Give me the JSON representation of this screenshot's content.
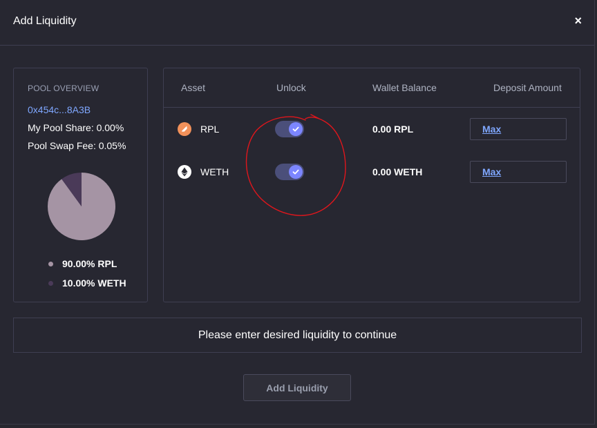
{
  "modal": {
    "title": "Add Liquidity",
    "close_label": "×"
  },
  "pool_overview": {
    "label": "POOL OVERVIEW",
    "address": "0x454c...8A3B",
    "my_pool_share": "My Pool Share: 0.00%",
    "swap_fee": "Pool Swap Fee: 0.05%",
    "composition": [
      {
        "label": "90.00% RPL",
        "percent": 90,
        "color": "#a594a4"
      },
      {
        "label": "10.00% WETH",
        "percent": 10,
        "color": "#4a3a58"
      }
    ]
  },
  "assets_table": {
    "headers": {
      "asset": "Asset",
      "unlock": "Unlock",
      "wallet_balance": "Wallet Balance",
      "deposit_amount": "Deposit Amount"
    },
    "rows": [
      {
        "token": "RPL",
        "icon": "rpl-token-icon",
        "unlocked": true,
        "balance": "0.00 RPL",
        "max_label": "Max"
      },
      {
        "token": "WETH",
        "icon": "eth-token-icon",
        "unlocked": true,
        "balance": "0.00 WETH",
        "max_label": "Max"
      }
    ]
  },
  "message": "Please enter desired liquidity to continue",
  "add_button_label": "Add Liquidity",
  "colors": {
    "accent": "#7c86ff",
    "link": "#7fa7ff",
    "annotation": "#e0161c"
  }
}
